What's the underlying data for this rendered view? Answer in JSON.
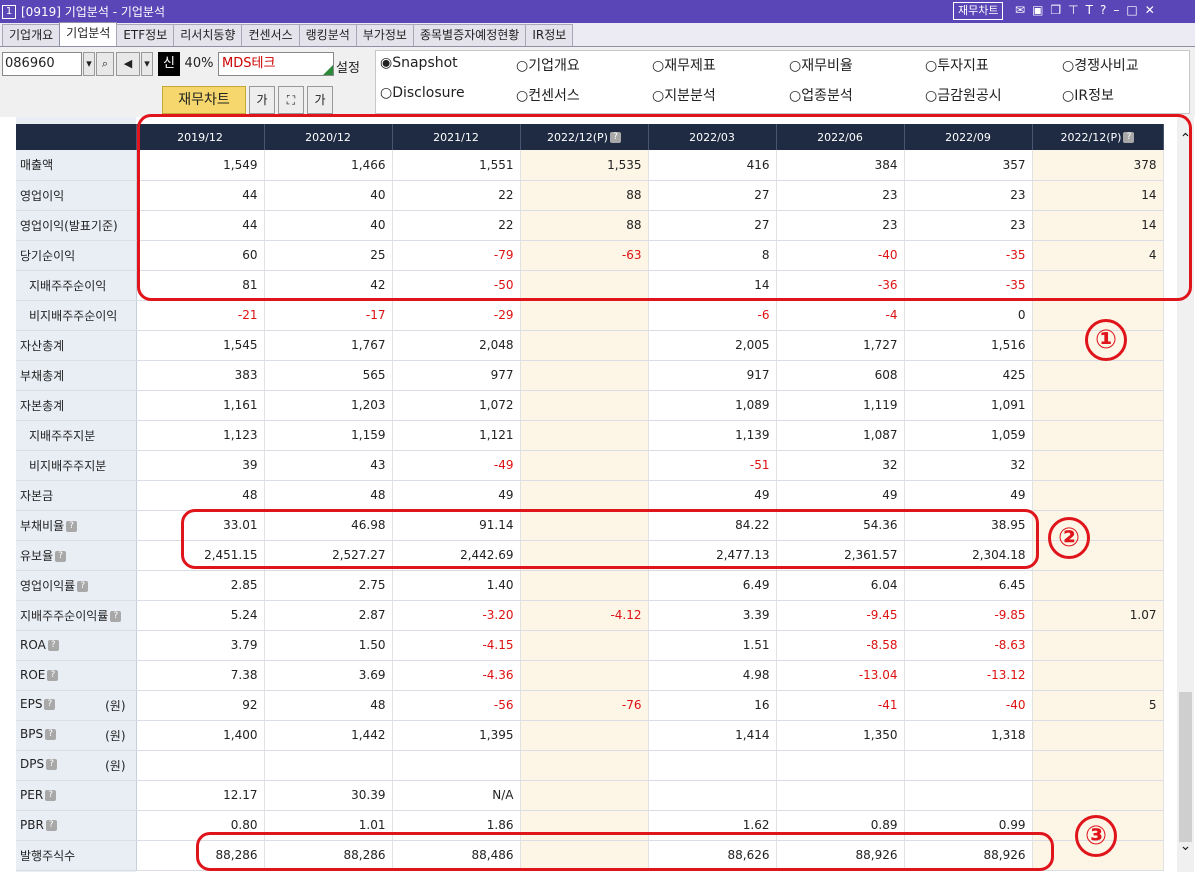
{
  "window": {
    "number": "1",
    "title": "[0919] 기업분석 - 기업분석",
    "chart_button": "재무차트",
    "icons": [
      "mail-icon",
      "layout-icon",
      "restore-icon",
      "pin-icon",
      "font-icon",
      "help-icon",
      "minimize-icon",
      "maximize-icon",
      "close-icon"
    ]
  },
  "tabs": [
    "기업개요",
    "기업분석",
    "ETF정보",
    "리서치동향",
    "컨센서스",
    "랭킹분석",
    "부가정보",
    "종목별증자예정현황",
    "IR정보"
  ],
  "active_tab": "기업분석",
  "toolbar": {
    "code": "086960",
    "badge": "신",
    "percent": "40%",
    "company": "MDS테크",
    "setting": "설정",
    "chart_button": "재무차트",
    "font_btn1": "가",
    "font_btn2": "가"
  },
  "radios": [
    {
      "label": "Snapshot",
      "selected": true
    },
    {
      "label": "기업개요",
      "selected": false
    },
    {
      "label": "재무제표",
      "selected": false
    },
    {
      "label": "재무비율",
      "selected": false
    },
    {
      "label": "투자지표",
      "selected": false
    },
    {
      "label": "경쟁사비교",
      "selected": false
    },
    {
      "label": "Disclosure",
      "selected": false
    },
    {
      "label": "컨센서스",
      "selected": false
    },
    {
      "label": "지분분석",
      "selected": false
    },
    {
      "label": "업종분석",
      "selected": false
    },
    {
      "label": "금감원공시",
      "selected": false
    },
    {
      "label": "IR정보",
      "selected": false
    }
  ],
  "table": {
    "headers": [
      "2019/12",
      "2020/12",
      "2021/12",
      "2022/12(P)",
      "2022/03",
      "2022/06",
      "2022/09",
      "2022/12(P)"
    ],
    "rows": [
      {
        "label": "매출액",
        "vals": [
          "1,549",
          "1,466",
          "1,551",
          "1,535",
          "416",
          "384",
          "357",
          "378"
        ]
      },
      {
        "label": "영업이익",
        "vals": [
          "44",
          "40",
          "22",
          "88",
          "27",
          "23",
          "23",
          "14"
        ]
      },
      {
        "label": "영업이익(발표기준)",
        "vals": [
          "44",
          "40",
          "22",
          "88",
          "27",
          "23",
          "23",
          "14"
        ]
      },
      {
        "label": "당기순이익",
        "vals": [
          "60",
          "25",
          "-79",
          "-63",
          "8",
          "-40",
          "-35",
          "4"
        ]
      },
      {
        "label": "지배주주순이익",
        "indent": true,
        "vals": [
          "81",
          "42",
          "-50",
          "",
          "14",
          "-36",
          "-35",
          ""
        ]
      },
      {
        "label": "비지배주주순이익",
        "indent": true,
        "vals": [
          "-21",
          "-17",
          "-29",
          "",
          "-6",
          "-4",
          "0",
          ""
        ]
      },
      {
        "label": "자산총계",
        "vals": [
          "1,545",
          "1,767",
          "2,048",
          "",
          "2,005",
          "1,727",
          "1,516",
          ""
        ]
      },
      {
        "label": "부채총계",
        "vals": [
          "383",
          "565",
          "977",
          "",
          "917",
          "608",
          "425",
          ""
        ]
      },
      {
        "label": "자본총계",
        "vals": [
          "1,161",
          "1,203",
          "1,072",
          "",
          "1,089",
          "1,119",
          "1,091",
          ""
        ]
      },
      {
        "label": "지배주주지분",
        "indent": true,
        "vals": [
          "1,123",
          "1,159",
          "1,121",
          "",
          "1,139",
          "1,087",
          "1,059",
          ""
        ]
      },
      {
        "label": "비지배주주지분",
        "indent": true,
        "vals": [
          "39",
          "43",
          "-49",
          "",
          "-51",
          "32",
          "32",
          ""
        ]
      },
      {
        "label": "자본금",
        "vals": [
          "48",
          "48",
          "49",
          "",
          "49",
          "49",
          "49",
          ""
        ]
      },
      {
        "label": "부채비율",
        "help": true,
        "vals": [
          "33.01",
          "46.98",
          "91.14",
          "",
          "84.22",
          "54.36",
          "38.95",
          ""
        ]
      },
      {
        "label": "유보율",
        "help": true,
        "vals": [
          "2,451.15",
          "2,527.27",
          "2,442.69",
          "",
          "2,477.13",
          "2,361.57",
          "2,304.18",
          ""
        ]
      },
      {
        "label": "영업이익률",
        "help": true,
        "vals": [
          "2.85",
          "2.75",
          "1.40",
          "",
          "6.49",
          "6.04",
          "6.45",
          ""
        ]
      },
      {
        "label": "지배주주순이익률",
        "help": true,
        "vals": [
          "5.24",
          "2.87",
          "-3.20",
          "-4.12",
          "3.39",
          "-9.45",
          "-9.85",
          "1.07"
        ]
      },
      {
        "label": "ROA",
        "help": true,
        "vals": [
          "3.79",
          "1.50",
          "-4.15",
          "",
          "1.51",
          "-8.58",
          "-8.63",
          ""
        ]
      },
      {
        "label": "ROE",
        "help": true,
        "vals": [
          "7.38",
          "3.69",
          "-4.36",
          "",
          "4.98",
          "-13.04",
          "-13.12",
          ""
        ]
      },
      {
        "label": "EPS",
        "help": true,
        "unit": "(원)",
        "vals": [
          "92",
          "48",
          "-56",
          "-76",
          "16",
          "-41",
          "-40",
          "5"
        ]
      },
      {
        "label": "BPS",
        "help": true,
        "unit": "(원)",
        "vals": [
          "1,400",
          "1,442",
          "1,395",
          "",
          "1,414",
          "1,350",
          "1,318",
          ""
        ]
      },
      {
        "label": "DPS",
        "help": true,
        "unit": "(원)",
        "vals": [
          "",
          "",
          "",
          "",
          "",
          "",
          "",
          ""
        ]
      },
      {
        "label": "PER",
        "help": true,
        "vals": [
          "12.17",
          "30.39",
          "N/A",
          "",
          "",
          "",
          "",
          ""
        ]
      },
      {
        "label": "PBR",
        "help": true,
        "vals": [
          "0.80",
          "1.01",
          "1.86",
          "",
          "1.62",
          "0.89",
          "0.99",
          ""
        ]
      },
      {
        "label": "발행주식수",
        "vals": [
          "88,286",
          "88,286",
          "88,486",
          "",
          "88,626",
          "88,926",
          "88,926",
          ""
        ]
      }
    ]
  },
  "annotations": [
    "①",
    "②",
    "③"
  ],
  "colors": {
    "title_bar": "#5b46b7",
    "header_bg": "#1f2b42",
    "label_bg": "#e9eef5",
    "projection_bg": "#fdf5e6",
    "negative": "#dd1111",
    "annotation": "#e0141b"
  }
}
